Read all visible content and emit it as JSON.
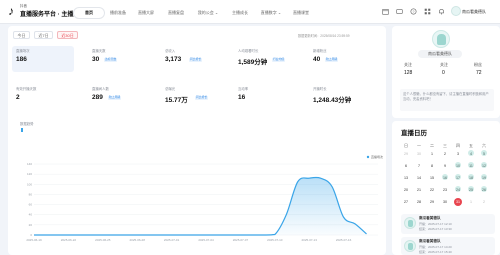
{
  "header": {
    "brand_small": "抖音",
    "brand_title": "直播服务平台 · 主播版",
    "nav": [
      {
        "label": "首页",
        "active": true
      },
      {
        "label": "播前准备",
        "active": false
      },
      {
        "label": "直播大屏",
        "active": false
      },
      {
        "label": "直播复盘",
        "active": false
      },
      {
        "label": "我的公会 ⌄",
        "active": false
      },
      {
        "label": "主播成长",
        "active": false
      },
      {
        "label": "直播数字 ⌄",
        "active": false
      },
      {
        "label": "直播课堂",
        "active": false
      }
    ],
    "username": "南瓜看美德队",
    "icons": [
      "calendar-icon",
      "message-icon",
      "help-icon",
      "grid-icon",
      "bell-icon"
    ]
  },
  "main": {
    "ranges": [
      {
        "label": "今日",
        "active": false
      },
      {
        "label": "近7日",
        "active": false
      },
      {
        "label": "近30日",
        "active": true
      }
    ],
    "range_note": "数据更新时间：2025/08/16 23:59:59",
    "metrics_row1": [
      {
        "label": "直播场次",
        "value": "186",
        "tag": ""
      },
      {
        "label": "直播天数",
        "value": "30",
        "tag": "达标天数"
      },
      {
        "label": "总收入",
        "value": "3,173",
        "tag": "同比增长"
      },
      {
        "label": "人均观看时长",
        "value": "1,589分钟",
        "tag": "行业均值"
      },
      {
        "label": "新增粉丝",
        "value": "40",
        "tag": "较上周期"
      }
    ],
    "metrics_row2": [
      {
        "label": "有效开播天数",
        "value": "2",
        "tag": ""
      },
      {
        "label": "直播间人数",
        "value": "289",
        "tag": "较上周期"
      },
      {
        "label": "总曝光",
        "value": "15.77万",
        "tag": "同比增长"
      },
      {
        "label": "互动率",
        "value": "16",
        "tag": ""
      },
      {
        "label": "开播时长",
        "value": "1,248.43分钟",
        "tag": ""
      }
    ],
    "trend_label": "数据趋势"
  },
  "chart_data": {
    "type": "area",
    "title": "",
    "xlabel": "",
    "ylabel": "",
    "x": [
      "2025-06-19",
      "2025-06-22",
      "2025-06-25",
      "2025-06-28",
      "2025-07-01",
      "2025-07-04",
      "2025-07-07",
      "2025-07-10",
      "2025-07-13",
      "2025-07-16"
    ],
    "ylim": [
      0,
      140
    ],
    "yticks": [
      0,
      20,
      40,
      60,
      80,
      100,
      120,
      140
    ],
    "series": [
      {
        "name": "直播场次",
        "color": "#3aa5e8",
        "points": [
          [
            "2025-06-19",
            0
          ],
          [
            "2025-06-22",
            0
          ],
          [
            "2025-06-25",
            0
          ],
          [
            "2025-06-28",
            0
          ],
          [
            "2025-07-01",
            0
          ],
          [
            "2025-07-04",
            0
          ],
          [
            "2025-07-07",
            0
          ],
          [
            "2025-07-09",
            0
          ],
          [
            "2025-07-10",
            1
          ],
          [
            "2025-07-11",
            40
          ],
          [
            "2025-07-12",
            105
          ],
          [
            "2025-07-13",
            112
          ],
          [
            "2025-07-14",
            112
          ],
          [
            "2025-07-15",
            95
          ],
          [
            "2025-07-16",
            35
          ],
          [
            "2025-07-17",
            22
          ],
          [
            "2025-07-18",
            2
          ]
        ]
      }
    ],
    "legend": "top-right",
    "grid": true
  },
  "profile": {
    "name": "南瓜看美德队",
    "stats": [
      {
        "label": "关注",
        "value": "128"
      },
      {
        "label": "关注",
        "value": "0"
      },
      {
        "label": "粉丝",
        "value": "72"
      }
    ],
    "bio": "这个人很懒，什么都没有留下，请主播在直播时积极和用户互动，完善资料吧！"
  },
  "calendar": {
    "title": "直播日历",
    "weekdays": [
      "日",
      "一",
      "二",
      "三",
      "四",
      "五",
      "六"
    ],
    "weeks": [
      [
        {
          "d": "29",
          "dim": true,
          "ev": false
        },
        {
          "d": "30",
          "dim": true,
          "ev": false
        },
        {
          "d": "1",
          "dim": false,
          "ev": false
        },
        {
          "d": "2",
          "dim": false,
          "ev": false
        },
        {
          "d": "3",
          "dim": false,
          "ev": false
        },
        {
          "d": "4",
          "dim": false,
          "ev": true
        },
        {
          "d": "5",
          "dim": false,
          "ev": true
        }
      ],
      [
        {
          "d": "6",
          "dim": false,
          "ev": false
        },
        {
          "d": "7",
          "dim": false,
          "ev": false
        },
        {
          "d": "8",
          "dim": false,
          "ev": false
        },
        {
          "d": "9",
          "dim": false,
          "ev": false
        },
        {
          "d": "10",
          "dim": false,
          "ev": true
        },
        {
          "d": "11",
          "dim": false,
          "ev": true
        },
        {
          "d": "12",
          "dim": false,
          "ev": true
        }
      ],
      [
        {
          "d": "13",
          "dim": false,
          "ev": false
        },
        {
          "d": "14",
          "dim": false,
          "ev": false
        },
        {
          "d": "15",
          "dim": false,
          "ev": false
        },
        {
          "d": "16",
          "dim": false,
          "ev": true
        },
        {
          "d": "17",
          "dim": false,
          "ev": true
        },
        {
          "d": "18",
          "dim": false,
          "ev": true
        },
        {
          "d": "19",
          "dim": false,
          "ev": true
        }
      ],
      [
        {
          "d": "20",
          "dim": false,
          "ev": false
        },
        {
          "d": "21",
          "dim": false,
          "ev": false
        },
        {
          "d": "22",
          "dim": false,
          "ev": false
        },
        {
          "d": "23",
          "dim": false,
          "ev": false
        },
        {
          "d": "24",
          "dim": false,
          "ev": true
        },
        {
          "d": "25",
          "dim": false,
          "ev": true
        },
        {
          "d": "26",
          "dim": false,
          "ev": true
        }
      ],
      [
        {
          "d": "27",
          "dim": false,
          "ev": false
        },
        {
          "d": "28",
          "dim": false,
          "ev": false
        },
        {
          "d": "29",
          "dim": false,
          "ev": false
        },
        {
          "d": "30",
          "dim": false,
          "ev": false
        },
        {
          "d": "31",
          "dim": false,
          "ev": false,
          "today": true
        },
        {
          "d": "1",
          "dim": true,
          "ev": false
        },
        {
          "d": "2",
          "dim": true,
          "ev": false
        }
      ]
    ],
    "events": [
      {
        "title": "南瓜看美德队",
        "line1": "开播：2025-07-17 12:10",
        "line2": "结束：2025-07-17 13:30"
      },
      {
        "title": "南瓜看美德队",
        "line1": "开播：2025-07-17 14:20",
        "line2": "结束：2025-07-17 15:40"
      }
    ]
  }
}
